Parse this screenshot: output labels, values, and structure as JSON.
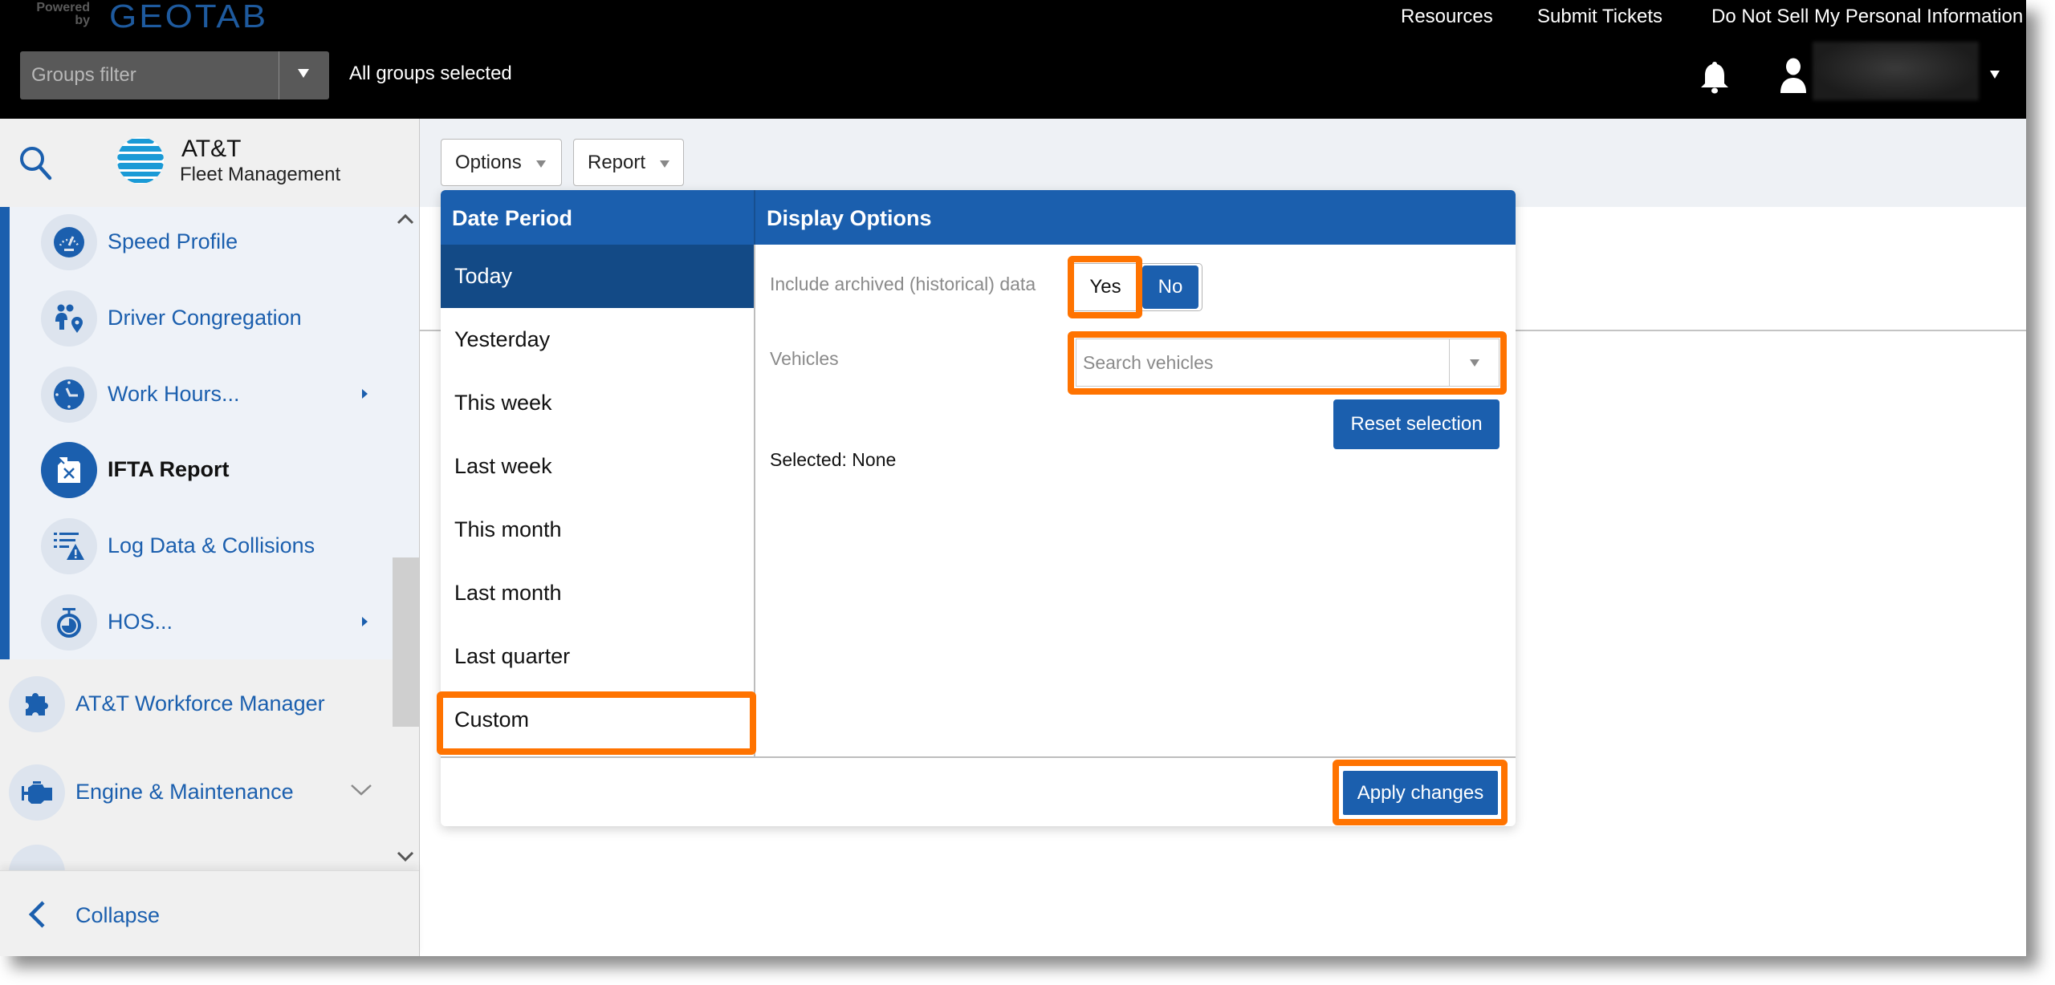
{
  "topbar": {
    "logo_powered": "Powered by",
    "logo_brand": "GEOTAB",
    "links": [
      "Resources",
      "Submit Tickets",
      "Do Not Sell My Personal Information"
    ],
    "groups_filter_placeholder": "Groups filter",
    "groups_status": "All groups selected",
    "icons": {
      "notifications": "bell-icon",
      "user": "user-icon"
    }
  },
  "sidebar": {
    "brand_title": "AT&T",
    "brand_subtitle": "Fleet Management",
    "sub_items": [
      {
        "label": "Speed Profile",
        "icon": "speedometer-icon",
        "has_submenu": false,
        "active": false
      },
      {
        "label": "Driver Congregation",
        "icon": "people-location-icon",
        "has_submenu": false,
        "active": false
      },
      {
        "label": "Work Hours...",
        "icon": "clock-icon",
        "has_submenu": true,
        "active": false
      },
      {
        "label": "IFTA Report",
        "icon": "fuel-can-icon",
        "has_submenu": false,
        "active": true
      },
      {
        "label": "Log Data & Collisions",
        "icon": "list-warning-icon",
        "has_submenu": false,
        "active": false
      },
      {
        "label": "HOS...",
        "icon": "stopwatch-icon",
        "has_submenu": true,
        "active": false
      }
    ],
    "top_items": [
      {
        "label": "AT&T Workforce Manager",
        "icon": "puzzle-icon",
        "expandable": false
      },
      {
        "label": "Engine & Maintenance",
        "icon": "engine-icon",
        "expandable": true
      }
    ],
    "collapse_label": "Collapse"
  },
  "toolbar": {
    "options_label": "Options",
    "report_label": "Report"
  },
  "options_panel": {
    "date_period_header": "Date Period",
    "display_options_header": "Display Options",
    "date_periods": [
      "Today",
      "Yesterday",
      "This week",
      "Last week",
      "This month",
      "Last month",
      "Last quarter",
      "Custom"
    ],
    "selected_period": "Today",
    "archived_label": "Include archived (historical) data",
    "archived_yes": "Yes",
    "archived_no": "No",
    "archived_value": "No",
    "vehicles_label": "Vehicles",
    "vehicles_placeholder": "Search vehicles",
    "reset_selection_label": "Reset selection",
    "selected_text": "Selected: None",
    "apply_label": "Apply changes"
  },
  "colors": {
    "brand_blue": "#1b5fae",
    "selected_blue": "#134a86",
    "highlight_orange": "#ff7300",
    "topbar_bg": "#000000"
  }
}
